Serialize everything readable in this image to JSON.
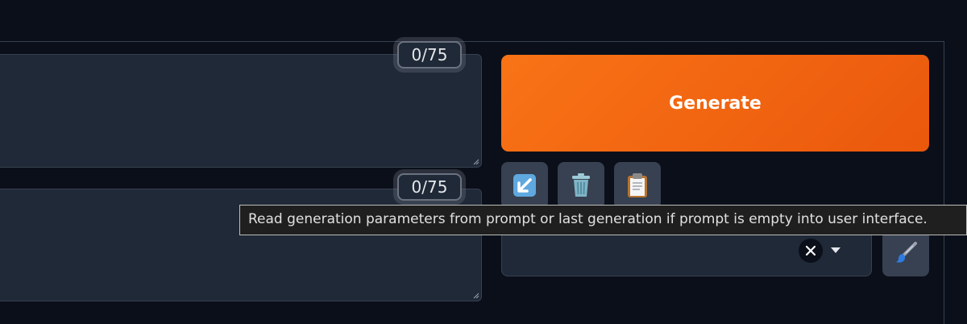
{
  "prompt": {
    "token_count": "0/75"
  },
  "negative_prompt": {
    "token_count": "0/75"
  },
  "generate_button": {
    "label": "Generate",
    "color": "#f97316"
  },
  "tools": [
    {
      "icon": "read-params-icon",
      "glyph": "↙️"
    },
    {
      "icon": "trash-icon",
      "glyph": "🗑️"
    },
    {
      "icon": "clipboard-icon",
      "glyph": "📋"
    }
  ],
  "styles": {
    "selected": ""
  },
  "tooltip": {
    "text": "Read generation parameters from prompt or last generation if prompt is empty into user interface."
  }
}
